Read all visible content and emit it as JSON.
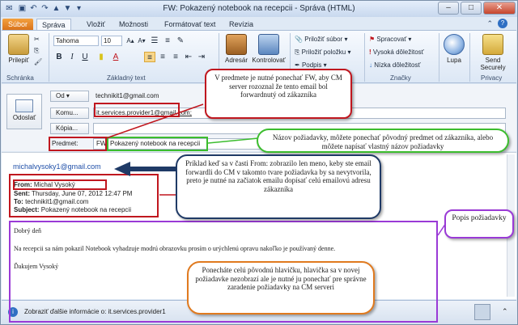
{
  "window": {
    "title": "FW: Pokazený notebook na recepcii  -  Správa (HTML)",
    "min": "–",
    "max": "□",
    "close": "✕"
  },
  "tabs": [
    "Súbor",
    "Správa",
    "Vložiť",
    "Možnosti",
    "Formátovať text",
    "Revízia"
  ],
  "ribbon": {
    "paste": "Prilepiť",
    "clipboard_group": "Schránka",
    "font_name": "Tahoma",
    "font_size": "10",
    "basic_text_group": "Základný text",
    "address_book": "Adresár",
    "check_names": "Kontrolovať",
    "attach_file": "Priložiť súbor",
    "attach_item": "Priložiť položku",
    "signature": "Podpis",
    "follow_up": "Spracovať",
    "high_importance": "Vysoká dôležitosť",
    "low_importance": "Nízka dôležitosť",
    "tags_group": "Značky",
    "zoom": "Lupa",
    "send_securely": "Send Securely",
    "privacy_group": "Privacy"
  },
  "header": {
    "send": "Odoslať",
    "from_btn": "Od",
    "from_value": "technikit1@gmail.com",
    "to_btn": "Komu...",
    "to_value": "it.services.provider1@gmail.com;",
    "cc_btn": "Kópia...",
    "subject_label": "Predmet:",
    "subject_prefix": "FW:",
    "subject_value": "Pokazený notebook na recepcii"
  },
  "body": {
    "forward_addr": "michalvysoky1@gmail.com",
    "from_line_label": "From:",
    "from_line_value": "Michal Vysoký",
    "sent_label": "Sent:",
    "sent_value": "Thursday, June 07, 2012 12:47 PM",
    "to_label": "To:",
    "to_value": "technikit1@gmail.com",
    "subject_label": "Subject:",
    "subject_value": "Pokazený notebook na recepcii",
    "greeting": "Dobrý deň",
    "text": "Na recepcii sa nám pokazil Notebook vyhadzuje modrú obrazovku prosím o urýchlenú opravu nakoľko je používaný denne.",
    "thanks": "Ďakujem   Vysoký"
  },
  "status": {
    "info": "Zobraziť ďalšie informácie o: it.services.provider1"
  },
  "callouts": {
    "subject_note": "V predmete je nutné ponechať FW, aby CM server rozoznal že tento email bol forwardnutý od zákazníka",
    "name_note": "Názov požiadavky, môžete ponechať pôvodný predmet od zákazníka, alebo môžete napísať vlastný názov požiadavky",
    "from_note": "Príklad keď sa v časti From: zobrazilo len meno, keby ste email forwardli do CM v takomto tvare požiadavka by sa nevytvorila, preto je nutné na začiatok emailu dopísať celú emailovú adresu zákazníka",
    "desc_note": "Popis požiadavky",
    "header_note": "Ponecháte celú pôvodnú hlavičku, hlavička sa v novej požiadavke nezobrazí ale je nutné ju ponechať pre správne zaradenie požiadavky na CM serveri"
  },
  "colors": {
    "red": "#c0171f",
    "green": "#3cbd2e",
    "purple": "#9a3ad6",
    "navy": "#1f3a66",
    "orange": "#e07a1f"
  }
}
